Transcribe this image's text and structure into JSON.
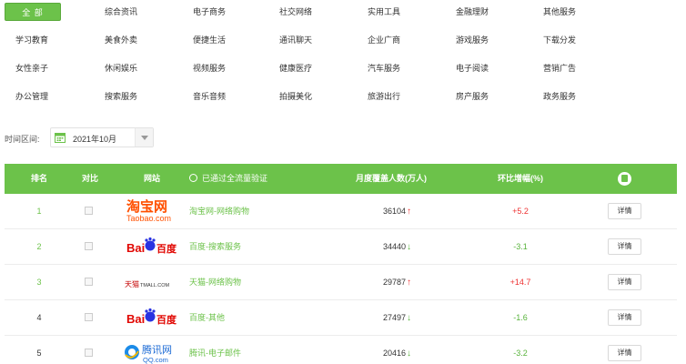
{
  "categories": {
    "all_label": "全 部",
    "items": [
      "综合资讯",
      "电子商务",
      "社交网络",
      "实用工具",
      "金融理财",
      "其他服务",
      "学习教育",
      "美食外卖",
      "便捷生活",
      "通讯聊天",
      "企业广商",
      "游戏服务",
      "下载分发",
      "女性亲子",
      "休闲娱乐",
      "视频服务",
      "健康医疗",
      "汽车服务",
      "电子阅读",
      "营销广告",
      "办公管理",
      "搜索服务",
      "音乐音频",
      "拍摄美化",
      "旅游出行",
      "房产服务",
      "政务服务"
    ]
  },
  "filter": {
    "range_label": "时间区间:",
    "date_value": "2021年10月"
  },
  "table": {
    "headers": {
      "rank": "排名",
      "compare": "对比",
      "site": "网站",
      "verified": "已通过全流量验证",
      "users": "月度覆盖人数(万人)",
      "change": "环比增幅(%)"
    },
    "detail_label": "详情",
    "rows": [
      {
        "rank": "1",
        "logo": "taobao",
        "logo_text_1": "淘宝网",
        "logo_text_2": "Taobao.com",
        "site": "淘宝网-网络购物",
        "users": "36104",
        "trend": "↑",
        "change": "+5.2"
      },
      {
        "rank": "2",
        "logo": "baidu",
        "logo_text_1": "Bai",
        "logo_text_2": "百度",
        "site": "百度-搜索服务",
        "users": "34440",
        "trend": "↓",
        "change": "-3.1"
      },
      {
        "rank": "3",
        "logo": "tmall",
        "logo_text_1": "天猫",
        "logo_text_2": "TMALL.COM",
        "site": "天猫-网络购物",
        "users": "29787",
        "trend": "↑",
        "change": "+14.7"
      },
      {
        "rank": "4",
        "logo": "baidu",
        "logo_text_1": "Bai",
        "logo_text_2": "百度",
        "site": "百度-其他",
        "users": "27497",
        "trend": "↓",
        "change": "-1.6"
      },
      {
        "rank": "5",
        "logo": "qq",
        "logo_text_1": "腾讯网",
        "logo_text_2": "QQ.com",
        "site": "腾讯-电子邮件",
        "users": "20416",
        "trend": "↓",
        "change": "-3.2"
      }
    ]
  },
  "colors": {
    "accent": "#6cc24a",
    "up": "#e33333",
    "down": "#58b33b"
  }
}
